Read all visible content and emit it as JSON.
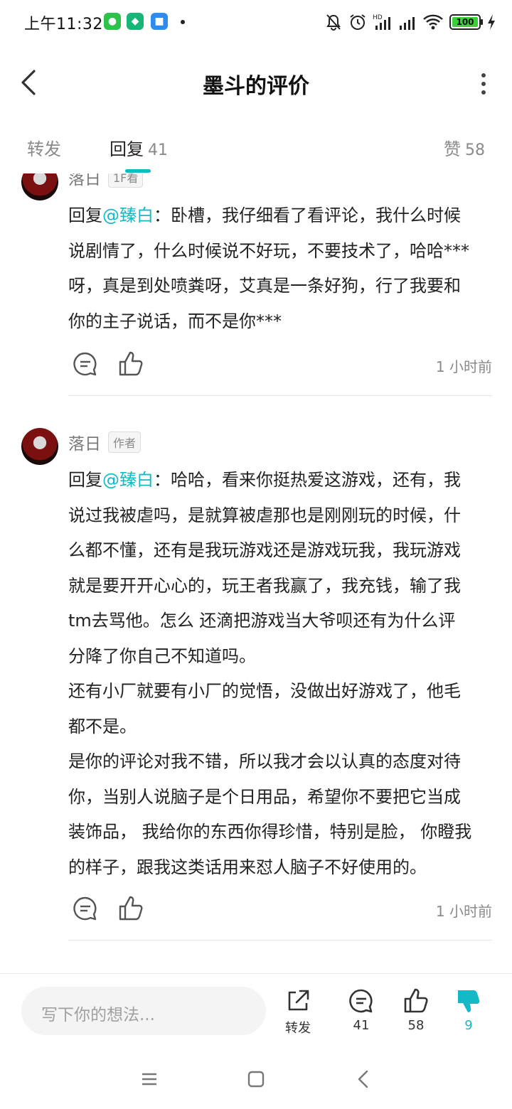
{
  "status_bar": {
    "time": "上午11:32",
    "battery": "100",
    "icons": [
      "wechat-icon",
      "shield-app-icon",
      "chat-app-icon",
      "mute-icon",
      "alarm-icon",
      "hd-signal-icon",
      "signal-icon",
      "wifi-icon",
      "battery-icon",
      "charging-icon"
    ]
  },
  "header": {
    "title": "墨斗的评价",
    "back_icon": "back-arrow-icon",
    "more_icon": "more-vertical-icon"
  },
  "tabs": {
    "repost": "转发",
    "reply": "回复",
    "reply_count": "41",
    "like": "赞",
    "like_count": "58"
  },
  "comments": [
    {
      "author": "落日",
      "badge": "1F看",
      "reply_prefix": "回复",
      "mention": "@臻白",
      "lines": [
        "：卧槽，我仔细看了看评论，我什么时候",
        "说剧情了，什么时候说不好玩，不要技术了，哈哈***",
        "呀，真是到处喷粪呀，艾真是一条好狗，行了我要和",
        "你的主子说话，而不是你***"
      ],
      "time": "1 小时前"
    },
    {
      "author": "落日",
      "badge": "作者",
      "reply_prefix": "回复",
      "mention": "@臻白",
      "lines": [
        "：哈哈，看来你挺热爱这游戏，还有，我",
        "说过我被虐吗，是就算被虐那也是刚刚玩的时候，什",
        "么都不懂，还有是我玩游戏还是游戏玩我，我玩游戏",
        "就是要开开心心的，玩王者我赢了，我充钱，输了我",
        "tm去骂他。怎么 还滴把游戏当大爷呗还有为什么评",
        "分降了你自己不知道吗。",
        "还有小厂就要有小厂的觉悟，没做出好游戏了，他毛",
        "都不是。",
        "是你的评论对我不错，所以我才会以认真的态度对待",
        "你，当别人说脑子是个日用品，希望你不要把它当成",
        "装饰品， 我给你的东西你得珍惜，特别是脸， 你瞪我",
        "的样子，跟我这类话用来怼人脑子不好使用的。"
      ],
      "time": "1 小时前"
    }
  ],
  "bottom_bar": {
    "placeholder": "写下你的想法...",
    "share_label": "转发",
    "comment_count": "41",
    "like_count": "58",
    "dislike_count": "9"
  },
  "colors": {
    "accent": "#14b9c8",
    "text": "#222222",
    "muted": "#8a8a8a"
  }
}
